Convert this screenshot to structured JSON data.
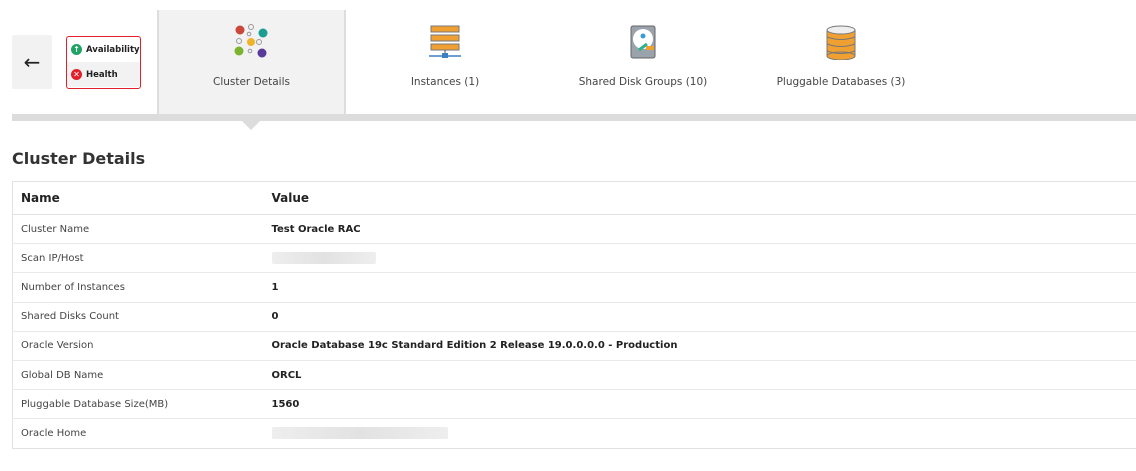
{
  "status": {
    "availability": "Availability",
    "health": "Health"
  },
  "tabs": [
    {
      "label": "Cluster Details"
    },
    {
      "label": "Instances (1)"
    },
    {
      "label": "Shared Disk Groups (10)"
    },
    {
      "label": "Pluggable Databases (3)"
    }
  ],
  "section_title": "Cluster Details",
  "table": {
    "headers": [
      "Name",
      "Value"
    ],
    "rows": [
      {
        "name": "Cluster Name",
        "value": "Test Oracle RAC"
      },
      {
        "name": "Scan IP/Host",
        "value": ""
      },
      {
        "name": "Number of Instances",
        "value": "1"
      },
      {
        "name": "Shared Disks Count",
        "value": "0"
      },
      {
        "name": "Oracle Version",
        "value": "Oracle Database 19c Standard Edition 2 Release 19.0.0.0.0 - Production"
      },
      {
        "name": "Global DB Name",
        "value": "ORCL"
      },
      {
        "name": "Pluggable Database Size(MB)",
        "value": "1560"
      },
      {
        "name": "Oracle Home",
        "value": ""
      }
    ]
  }
}
